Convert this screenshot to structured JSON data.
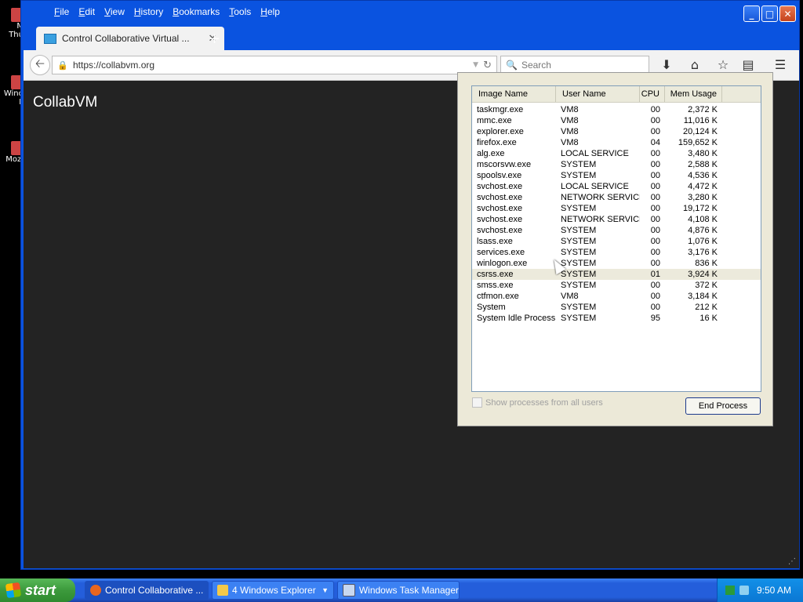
{
  "desktop": {
    "icons": [
      {
        "label": "M\nThu",
        "color": "#c44"
      },
      {
        "label": "Wind\nF",
        "color": "#c44"
      },
      {
        "label": "Mozi",
        "color": "#c44"
      }
    ]
  },
  "firefox": {
    "menu": [
      "File",
      "Edit",
      "View",
      "History",
      "Bookmarks",
      "Tools",
      "Help"
    ],
    "tab_title": "Control Collaborative Virtual ...",
    "url": "https://collabvm.org",
    "search_placeholder": "Search",
    "page_title": "CollabVM"
  },
  "taskmgr": {
    "columns": [
      "Image Name",
      "User Name",
      "CPU",
      "Mem Usage"
    ],
    "processes": [
      {
        "name": "taskmgr.exe",
        "user": "VM8",
        "cpu": "00",
        "mem": "2,372 K"
      },
      {
        "name": "mmc.exe",
        "user": "VM8",
        "cpu": "00",
        "mem": "11,016 K"
      },
      {
        "name": "explorer.exe",
        "user": "VM8",
        "cpu": "00",
        "mem": "20,124 K"
      },
      {
        "name": "firefox.exe",
        "user": "VM8",
        "cpu": "04",
        "mem": "159,652 K"
      },
      {
        "name": "alg.exe",
        "user": "LOCAL SERVICE",
        "cpu": "00",
        "mem": "3,480 K"
      },
      {
        "name": "mscorsvw.exe",
        "user": "SYSTEM",
        "cpu": "00",
        "mem": "2,588 K"
      },
      {
        "name": "spoolsv.exe",
        "user": "SYSTEM",
        "cpu": "00",
        "mem": "4,536 K"
      },
      {
        "name": "svchost.exe",
        "user": "LOCAL SERVICE",
        "cpu": "00",
        "mem": "4,472 K"
      },
      {
        "name": "svchost.exe",
        "user": "NETWORK SERVICE",
        "cpu": "00",
        "mem": "3,280 K"
      },
      {
        "name": "svchost.exe",
        "user": "SYSTEM",
        "cpu": "00",
        "mem": "19,172 K"
      },
      {
        "name": "svchost.exe",
        "user": "NETWORK SERVICE",
        "cpu": "00",
        "mem": "4,108 K"
      },
      {
        "name": "svchost.exe",
        "user": "SYSTEM",
        "cpu": "00",
        "mem": "4,876 K"
      },
      {
        "name": "lsass.exe",
        "user": "SYSTEM",
        "cpu": "00",
        "mem": "1,076 K"
      },
      {
        "name": "services.exe",
        "user": "SYSTEM",
        "cpu": "00",
        "mem": "3,176 K"
      },
      {
        "name": "winlogon.exe",
        "user": "SYSTEM",
        "cpu": "00",
        "mem": "836 K"
      },
      {
        "name": "csrss.exe",
        "user": "SYSTEM",
        "cpu": "01",
        "mem": "3,924 K",
        "selected": true
      },
      {
        "name": "smss.exe",
        "user": "SYSTEM",
        "cpu": "00",
        "mem": "372 K"
      },
      {
        "name": "ctfmon.exe",
        "user": "VM8",
        "cpu": "00",
        "mem": "3,184 K"
      },
      {
        "name": "System",
        "user": "SYSTEM",
        "cpu": "00",
        "mem": "212 K"
      },
      {
        "name": "System Idle Process",
        "user": "SYSTEM",
        "cpu": "95",
        "mem": "16 K"
      }
    ],
    "show_all_label": "Show processes from all users",
    "end_process_label": "End Process"
  },
  "taskbar": {
    "start_label": "start",
    "tasks": [
      {
        "label": "Control Collaborative ...",
        "icon": "firefox-icon",
        "color": "#e8661f"
      },
      {
        "label": "4 Windows Explorer",
        "icon": "folder-icon",
        "color": "#f3c94a"
      },
      {
        "label": "Windows Task Manager",
        "icon": "task-manager-icon",
        "color": "#c8d8f0"
      }
    ],
    "clock": "9:50 AM"
  },
  "colors": {
    "xp_blue": "#0a53e0",
    "page_bg": "#232323",
    "taskbar_blue": "#245edb",
    "start_green": "#3c9a3c"
  }
}
